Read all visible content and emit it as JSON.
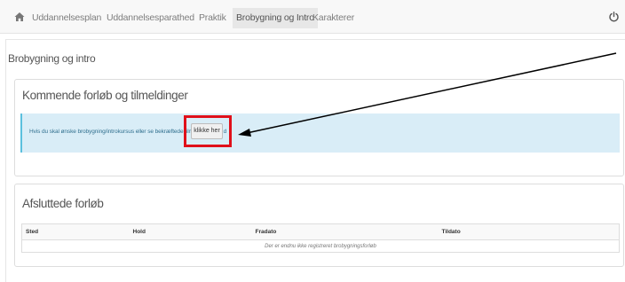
{
  "nav": {
    "home_icon": "home-icon",
    "items": [
      {
        "label": "Uddannelsesplan",
        "active": false
      },
      {
        "label": "Uddannelsesparathed",
        "active": false
      },
      {
        "label": "Praktik",
        "active": false
      },
      {
        "label": "Brobygning og Intro",
        "active": true
      },
      {
        "label": "Karakterer",
        "active": false
      }
    ],
    "power_icon": "power-icon"
  },
  "page": {
    "title": "Brobygning og intro"
  },
  "upcoming": {
    "heading": "Kommende forløb og tilmeldinger",
    "alert_text": "Hvis du skal ønske brobygning/introkursus eller se bekræftede tilmeldinger, så d",
    "button_label": "klikke her"
  },
  "finished": {
    "heading": "Afsluttede forløb",
    "columns": [
      "Sted",
      "Hold",
      "Fradato",
      "Tildato"
    ],
    "empty_message": "Der er endnu ikke registreret brobygningsforløb"
  },
  "colors": {
    "highlight": "#e0101a",
    "alert_bg": "#d9edf7",
    "alert_border": "#5bc0de"
  }
}
